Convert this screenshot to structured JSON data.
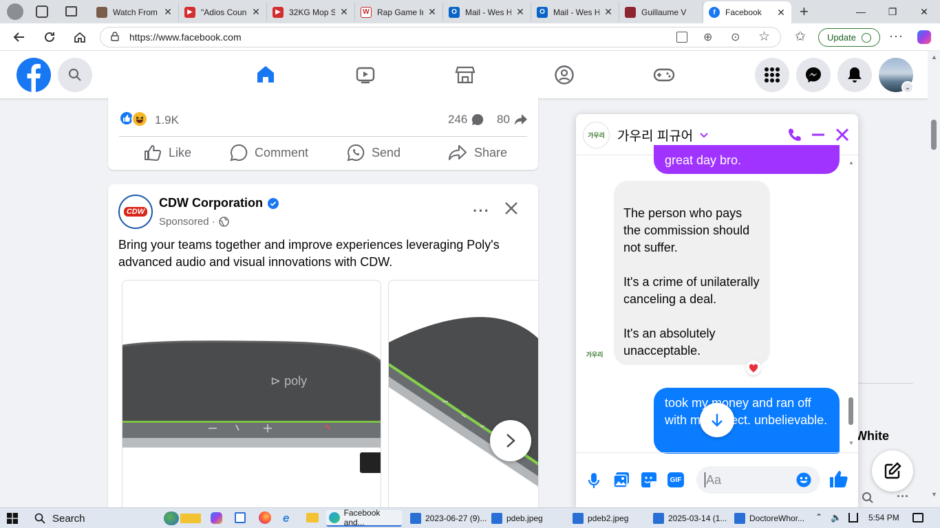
{
  "browser": {
    "tabs": [
      {
        "title": "Watch From",
        "favicon_color": "#7a5c4a"
      },
      {
        "title": "\"Adios Coun",
        "favicon_color": "#d32f2f"
      },
      {
        "title": "32KG Mop S",
        "favicon_color": "#d32f2f"
      },
      {
        "title": "Rap Game Ir",
        "favicon_color": "#c62828"
      },
      {
        "title": "Mail - Wes H",
        "favicon_color": "#0a64c8"
      },
      {
        "title": "Mail - Wes H",
        "favicon_color": "#0a64c8"
      },
      {
        "title": "Guillaume V",
        "favicon_color": "#8e2430"
      },
      {
        "title": "Facebook",
        "favicon_color": "#1877f2"
      }
    ],
    "url": "https://www.facebook.com",
    "update_label": "Update"
  },
  "feed": {
    "reactions_count": "1.9K",
    "comments_count": "246",
    "shares_count": "80",
    "actions": {
      "like": "Like",
      "comment": "Comment",
      "send": "Send",
      "share": "Share"
    },
    "ad": {
      "logo_text": "CDW",
      "advertiser": "CDW Corporation",
      "sponsored": "Sponsored ·",
      "body": "Bring your teams together and improve experiences leveraging Poly's advanced audio and visual innovations with CDW.",
      "product_brand": "poly"
    }
  },
  "chat": {
    "contact_name": "가우리 피규어",
    "messages": [
      {
        "from": "me",
        "text": "great day bro."
      },
      {
        "from": "them",
        "text": "The person who pays the commission should not suffer.\n\nIt's a crime of unilaterally canceling a deal.\n\nIt's an absolutely unacceptable."
      },
      {
        "from": "me",
        "text": "took my money and ran off with my project. unbelievable."
      }
    ],
    "input_placeholder": "Aa",
    "avatar_text": "가우리"
  },
  "right_partial_text": "White",
  "taskbar": {
    "search_label": "Search",
    "items": [
      "Facebook and...",
      "2023-06-27 (9)...",
      "pdeb.jpeg",
      "pdeb2.jpeg",
      "2025-03-14 (1...",
      "DoctoreWhor..."
    ],
    "clock": "5:54 PM"
  },
  "colors": {
    "fb_blue": "#1877f2",
    "messenger_purple": "#a033ff",
    "chat_blue": "#0a7cff"
  }
}
